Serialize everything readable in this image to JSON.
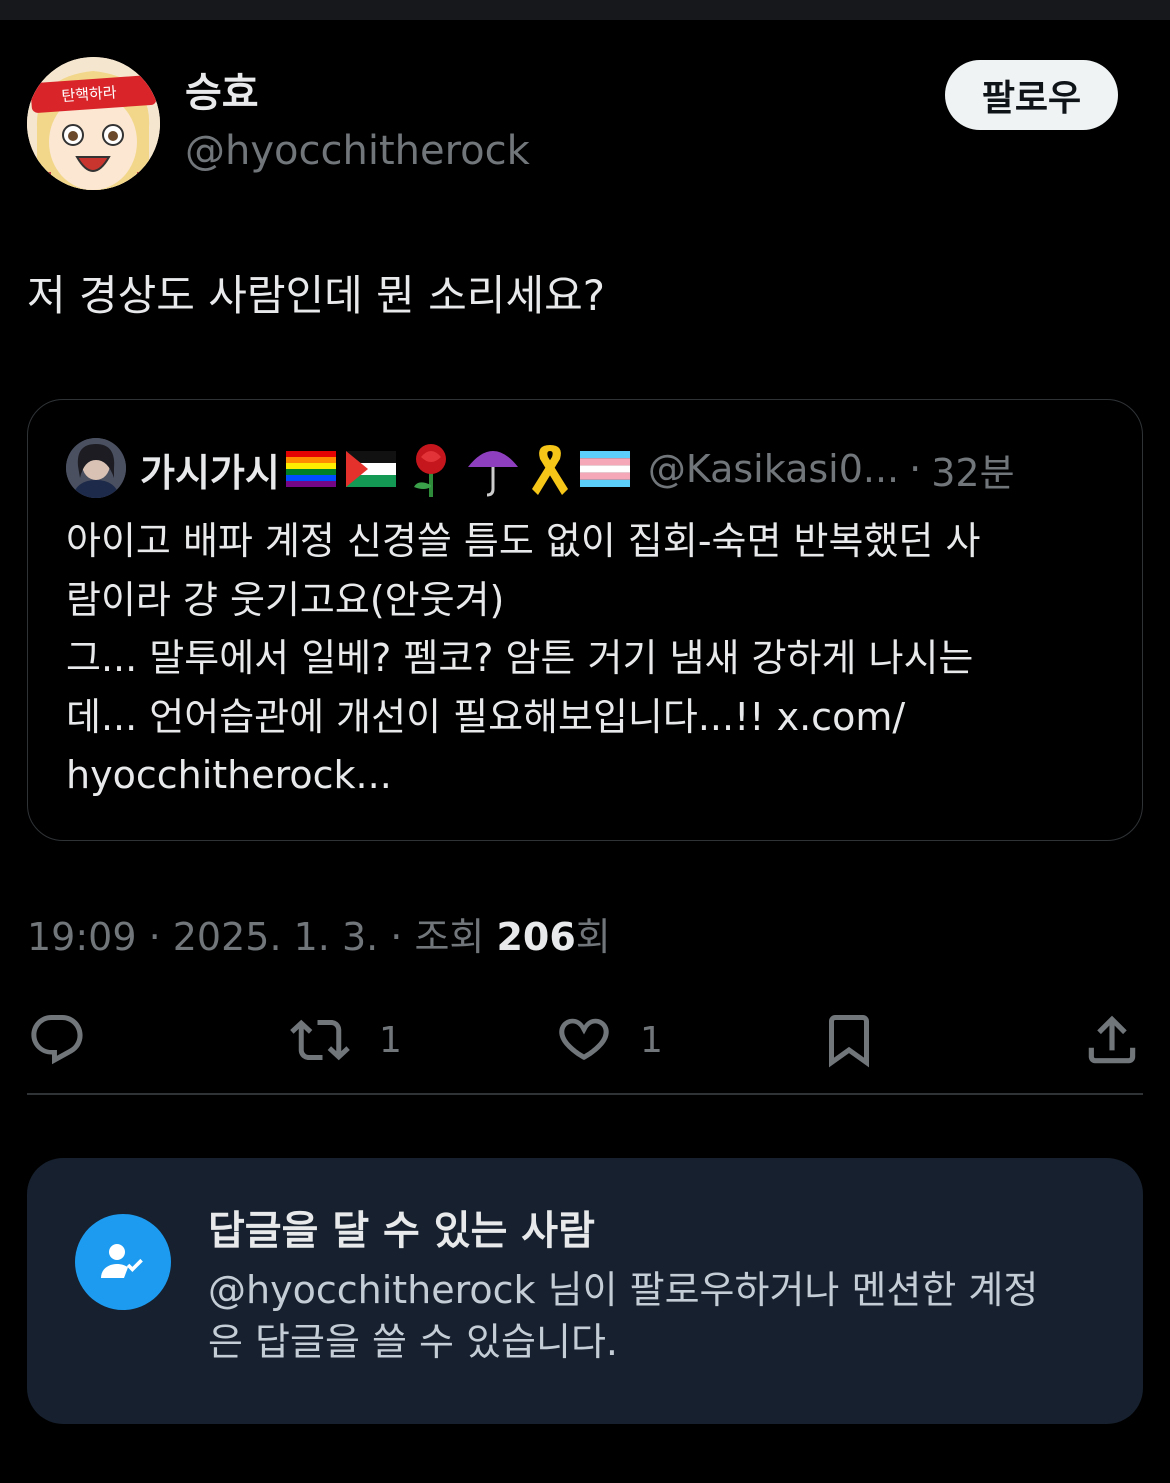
{
  "author": {
    "display_name": "승효",
    "handle": "@hyocchitherock",
    "avatar_headband_text": "탄핵하라"
  },
  "follow_label": "팔로우",
  "tweet_text": "저 경상도 사람인데 뭔 소리세요?",
  "quote": {
    "display_name": "가시가시",
    "emojis": [
      "rainbow-flag",
      "palestine-flag",
      "rose",
      "umbrella",
      "yellow-ribbon",
      "transgender-flag"
    ],
    "handle": "@Kasikasi0...",
    "separator": "·",
    "time": "32분",
    "body_lines": [
      "아이고 배파 계정 신경쓸 틈도 없이 집회-숙면 반복했던 사",
      "람이라 걍 웃기고요(안웃겨)",
      "그... 말투에서 일베? 펨코? 암튼 거기 냄새 강하게 나시는",
      "데... 언어습관에 개선이 필요해보입니다...!! x.com/",
      "hyocchitherock..."
    ]
  },
  "meta": {
    "prefix": "19:09 · 2025. 1. 3. · 조회 ",
    "views": "206",
    "suffix": "회"
  },
  "actions": {
    "reply_icon": "reply-icon",
    "retweet_count": "1",
    "like_count": "1",
    "bookmark_icon": "bookmark-icon",
    "share_icon": "share-icon"
  },
  "reply_restriction": {
    "title": "답글을 달 수 있는 사람",
    "desc_lines": [
      "@hyocchitherock 님이 팔로우하거나 멘션한 계정",
      "은 답글을 쓸 수 있습니다."
    ]
  },
  "colors": {
    "background": "#000000",
    "text": "#e7e9ea",
    "muted": "#71767b",
    "accent": "#1d9bf0",
    "card": "#16202e"
  }
}
